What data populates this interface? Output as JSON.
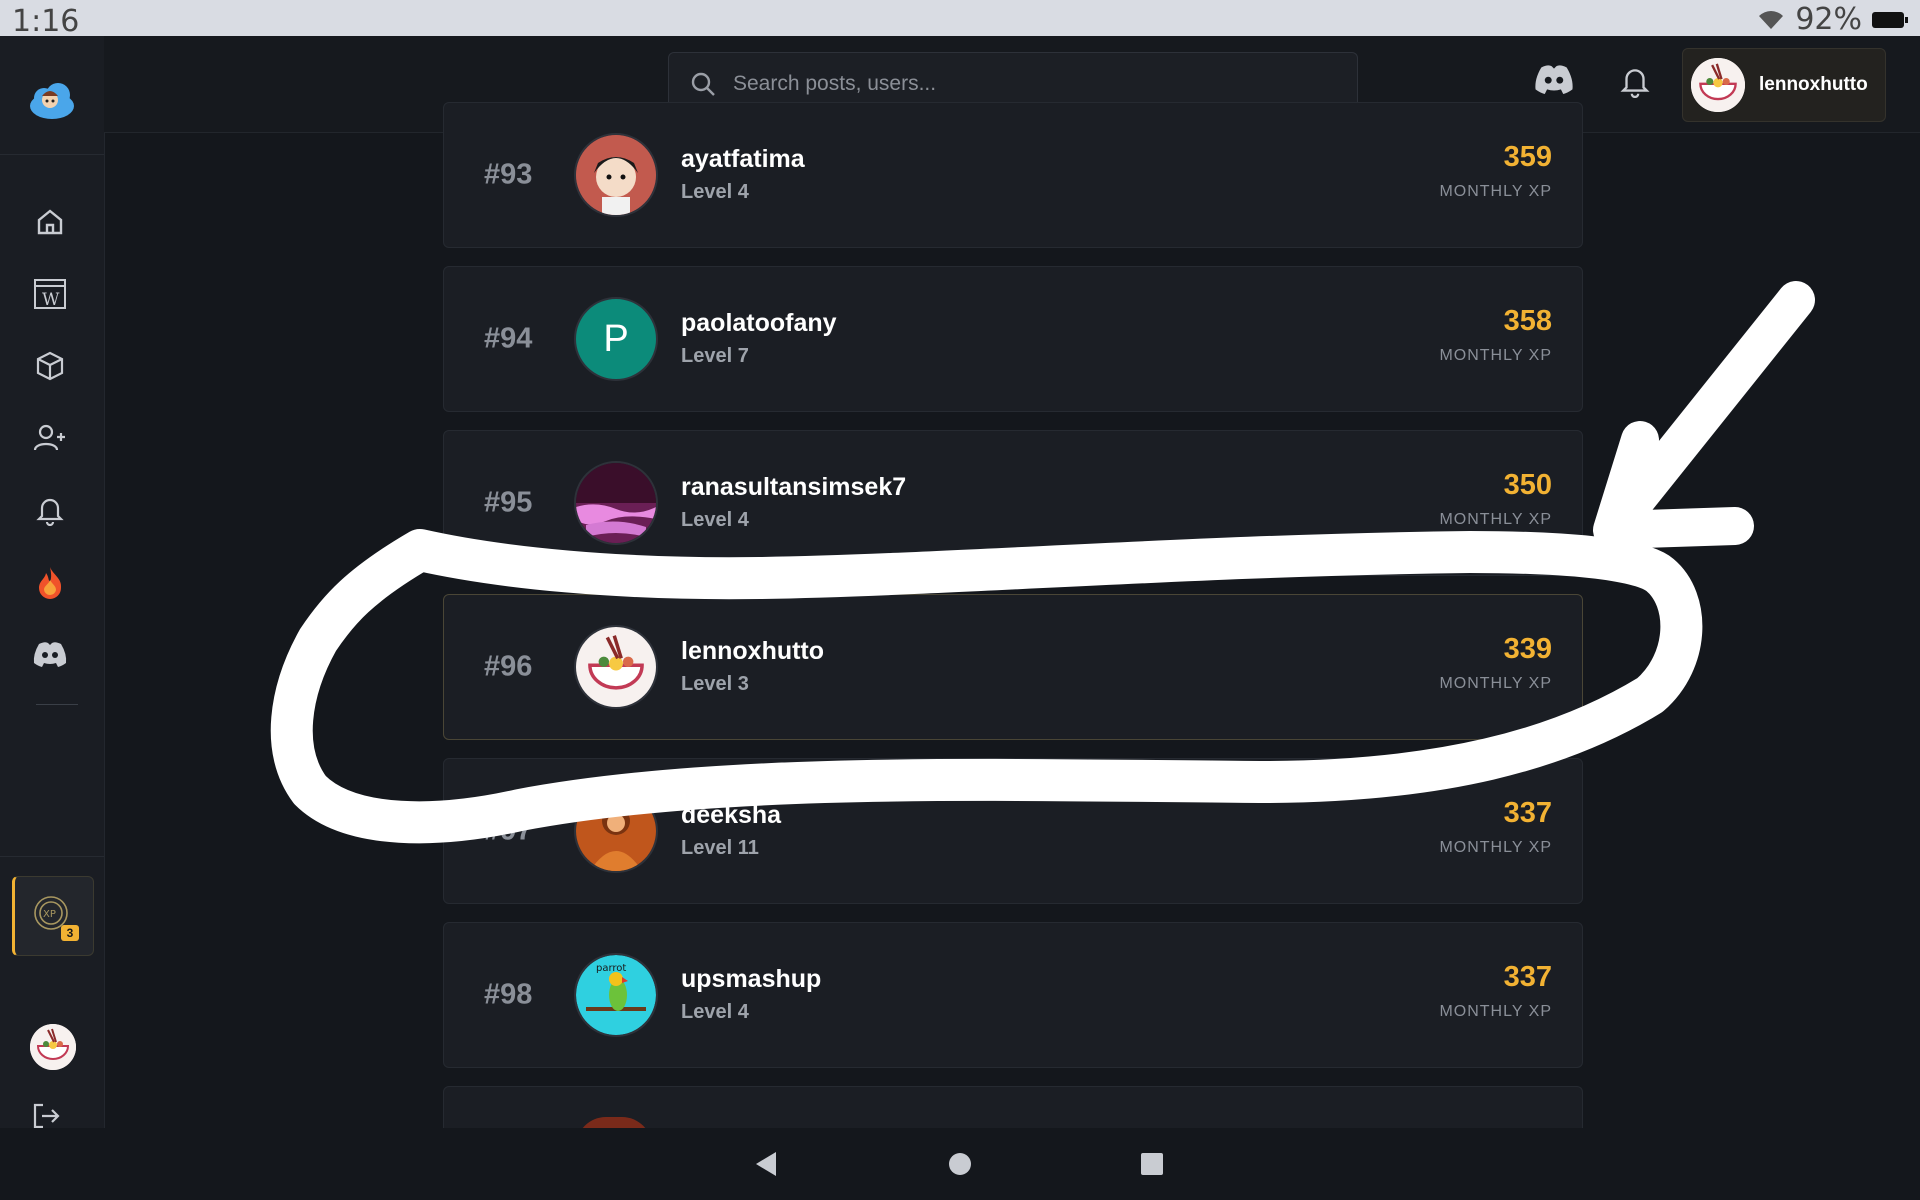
{
  "status_bar": {
    "time": "1:16",
    "battery": "92%"
  },
  "header": {
    "search_placeholder": "Search posts, users...",
    "username": "lennoxhutto"
  },
  "sidebar": {
    "items": [
      {
        "name": "home-icon"
      },
      {
        "name": "wiki-icon"
      },
      {
        "name": "cube-icon"
      },
      {
        "name": "add-user-icon"
      },
      {
        "name": "bell-icon"
      },
      {
        "name": "fire-icon"
      },
      {
        "name": "discord-icon"
      }
    ],
    "xp_badge": "3"
  },
  "leaderboard": {
    "xp_label": "MONTHLY XP",
    "rows": [
      {
        "rank": "#93",
        "username": "ayatfatima",
        "level": "Level 4",
        "xp": "359"
      },
      {
        "rank": "#94",
        "username": "paolatoofany",
        "level": "Level 7",
        "xp": "358",
        "initial": "P"
      },
      {
        "rank": "#95",
        "username": "ranasultansimsek7",
        "level": "Level 4",
        "xp": "350"
      },
      {
        "rank": "#96",
        "username": "lennoxhutto",
        "level": "Level 3",
        "xp": "339"
      },
      {
        "rank": "#97",
        "username": "deeksha",
        "level": "Level 11",
        "xp": "337"
      },
      {
        "rank": "#98",
        "username": "upsmashup",
        "level": "Level 4",
        "xp": "337"
      }
    ]
  },
  "colors": {
    "accent": "#f2b233",
    "background": "#14171c",
    "card": "#1b1e24",
    "annotation": "#ffffff"
  }
}
